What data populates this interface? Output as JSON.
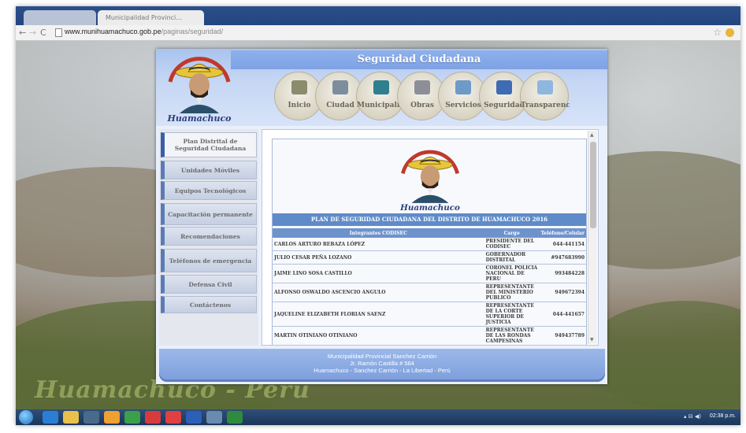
{
  "browser": {
    "tab_inactive": "",
    "tab_active": "Municipalidad Provinci...",
    "url_domain": "www.munihuamachuco.gob.pe",
    "url_path": "/paginas/seguridad/"
  },
  "header": {
    "title": "Seguridad Ciudadana",
    "logo_caption": "Huamachuco"
  },
  "menu": [
    {
      "label": "Inicio",
      "icon": "home-icon",
      "color": "#8b8b6e"
    },
    {
      "label": "Ciudad",
      "icon": "city-icon",
      "color": "#7c8d9e"
    },
    {
      "label": "Municipalidad",
      "icon": "municipality-icon",
      "color": "#2f7f8f"
    },
    {
      "label": "Obras",
      "icon": "works-icon",
      "color": "#8d8f98"
    },
    {
      "label": "Servicios",
      "icon": "services-icon",
      "color": "#6d9ac9"
    },
    {
      "label": "Seguridad",
      "icon": "security-icon",
      "color": "#3f6bb2"
    },
    {
      "label": "Transparencia",
      "icon": "magnifier-icon",
      "color": "#8fb6df"
    }
  ],
  "sidebar": {
    "items": [
      {
        "label": "Plan Distrital de Seguridad Ciudadana",
        "active": true
      },
      {
        "label": "Unidades Móviles",
        "active": false
      },
      {
        "label": "Equipos Tecnológicos",
        "active": false
      },
      {
        "label": "Capacitación permanente",
        "active": false
      },
      {
        "label": "Recomendaciones",
        "active": false
      },
      {
        "label": "Teléfonos de emergencia",
        "active": false
      },
      {
        "label": "Defensa Civil",
        "active": false
      },
      {
        "label": "Contáctenos",
        "active": false
      }
    ]
  },
  "content": {
    "logo_caption": "Huamachuco",
    "plan_title": "PLAN DE SEGURIDAD CIUDADANA DEL DISTRITO DE HUAMACHUCO 2016",
    "columns": [
      "Integrantes CODISEC",
      "Cargo",
      "Teléfono/Celular"
    ],
    "rows": [
      {
        "name": "CARLOS ARTURO REBAZA LÓPEZ",
        "cargo": "PRESIDENTE DEL CODISEC",
        "tel": "044-441154"
      },
      {
        "name": "JULIO CESAR PEÑA LOZANO",
        "cargo": "GOBERNADOR DISTRITAL",
        "tel": "#947683990"
      },
      {
        "name": "JAIME LINO SOSA CASTILLO",
        "cargo": "CORONEL POLICIA NACIONAL DE PERU",
        "tel": "993484228"
      },
      {
        "name": "ALFONSO OSWALDO ASCENCIO ANGULO",
        "cargo": "REPRESENTANTE DEL MINISTERIO PUBLICO",
        "tel": "949672394"
      },
      {
        "name": "JAQUELINE ELIZABETH FLORIAN SAENZ",
        "cargo": "REPRESENTANTE DE LA CORTE SUPERIOR DE JUSTICIA",
        "tel": "044-441657"
      },
      {
        "name": "MARTIN OTINIANO OTINIANO",
        "cargo": "REPRESENTANTE DE LAS RONDAS CAMPESINAS",
        "tel": "949437789"
      }
    ]
  },
  "footer": {
    "line1": "Municipalidad Provincial Sanchez Carrión",
    "line2": "Jr. Ramón Castilla # 564",
    "line3": "Huamachuco - Sanchez Carrión - La Libertad - Perú"
  },
  "desktop": {
    "watermark": "Huamachuco - Perú",
    "clock": "02:38 p.m."
  }
}
